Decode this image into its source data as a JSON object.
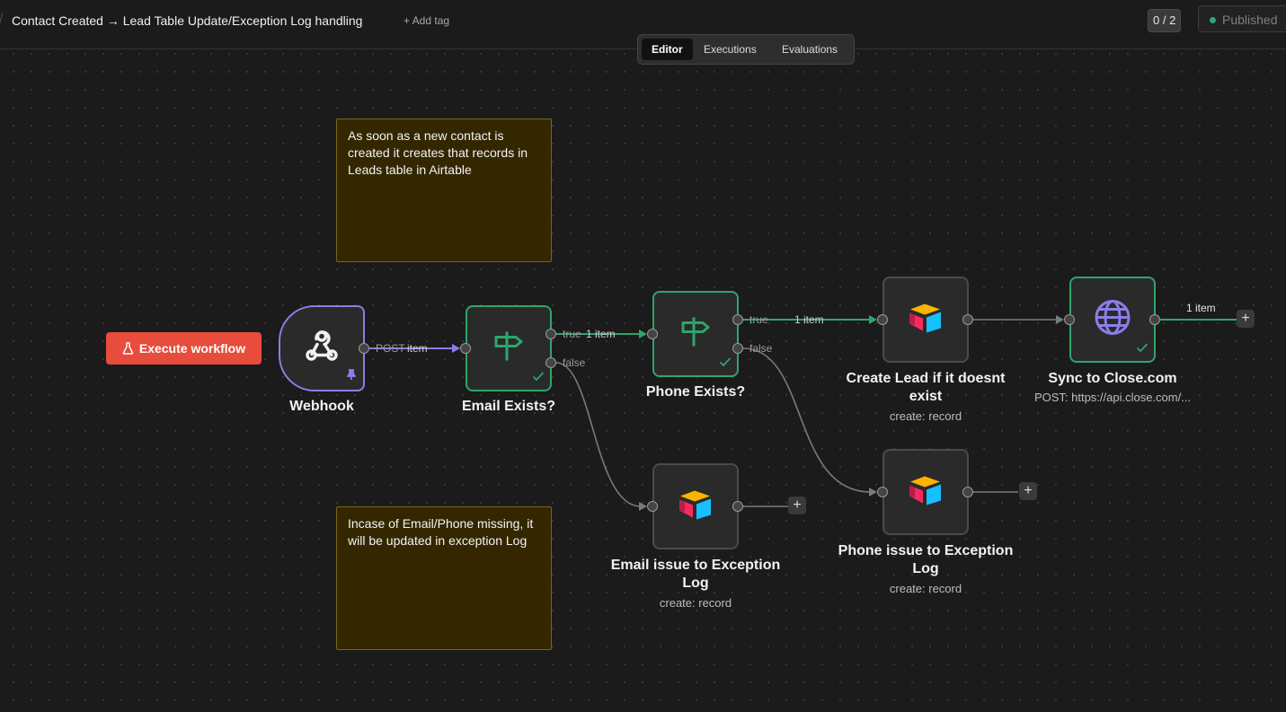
{
  "header": {
    "workflow_title": "Contact Created → Lead Table Update/Exception Log handling",
    "add_tag": "+ Add tag",
    "counter": "0 / 2",
    "status": "Published"
  },
  "tabs": [
    {
      "label": "Editor",
      "active": true
    },
    {
      "label": "Executions",
      "active": false
    },
    {
      "label": "Evaluations",
      "active": false
    }
  ],
  "notes": [
    {
      "text": "As soon as a new contact is created it creates that records in Leads table in Airtable"
    },
    {
      "text": "Incase of Email/Phone missing, it will be updated in exception Log"
    }
  ],
  "execute_button": "Execute workflow",
  "nodes": {
    "webhook": {
      "label": "Webhook",
      "icon": "webhook-icon",
      "pinned": true
    },
    "email_exists": {
      "label": "Email Exists?",
      "icon": "signpost-icon",
      "success": true
    },
    "phone_exists": {
      "label": "Phone Exists?",
      "icon": "signpost-icon",
      "success": true
    },
    "create_lead": {
      "label": "Create Lead if it doesnt exist",
      "subtitle": "create: record",
      "icon": "airtable-icon"
    },
    "sync_close": {
      "label": "Sync to Close.com",
      "subtitle": "POST: https://api.close.com/...",
      "icon": "globe-icon",
      "success": true
    },
    "email_issue": {
      "label": "Email issue to Exception Log",
      "subtitle": "create: record",
      "icon": "airtable-icon"
    },
    "phone_issue": {
      "label": "Phone issue to Exception Log",
      "subtitle": "create: record",
      "icon": "airtable-icon"
    }
  },
  "edges": {
    "webhook_out": "POST",
    "webhook_items": "item",
    "email_true": "true",
    "email_true_items": "1 item",
    "email_false": "false",
    "phone_true": "true",
    "phone_true_items": "1 item",
    "phone_false": "false",
    "sync_items": "1 item"
  },
  "add_node_symbol": "+",
  "colors": {
    "canvas": "#1b1b1b",
    "success": "#2ea56b",
    "trigger": "#8a7ee6",
    "execute": "#e74c3c",
    "sticky_bg": "#342700",
    "sticky_border": "#7a6416"
  }
}
